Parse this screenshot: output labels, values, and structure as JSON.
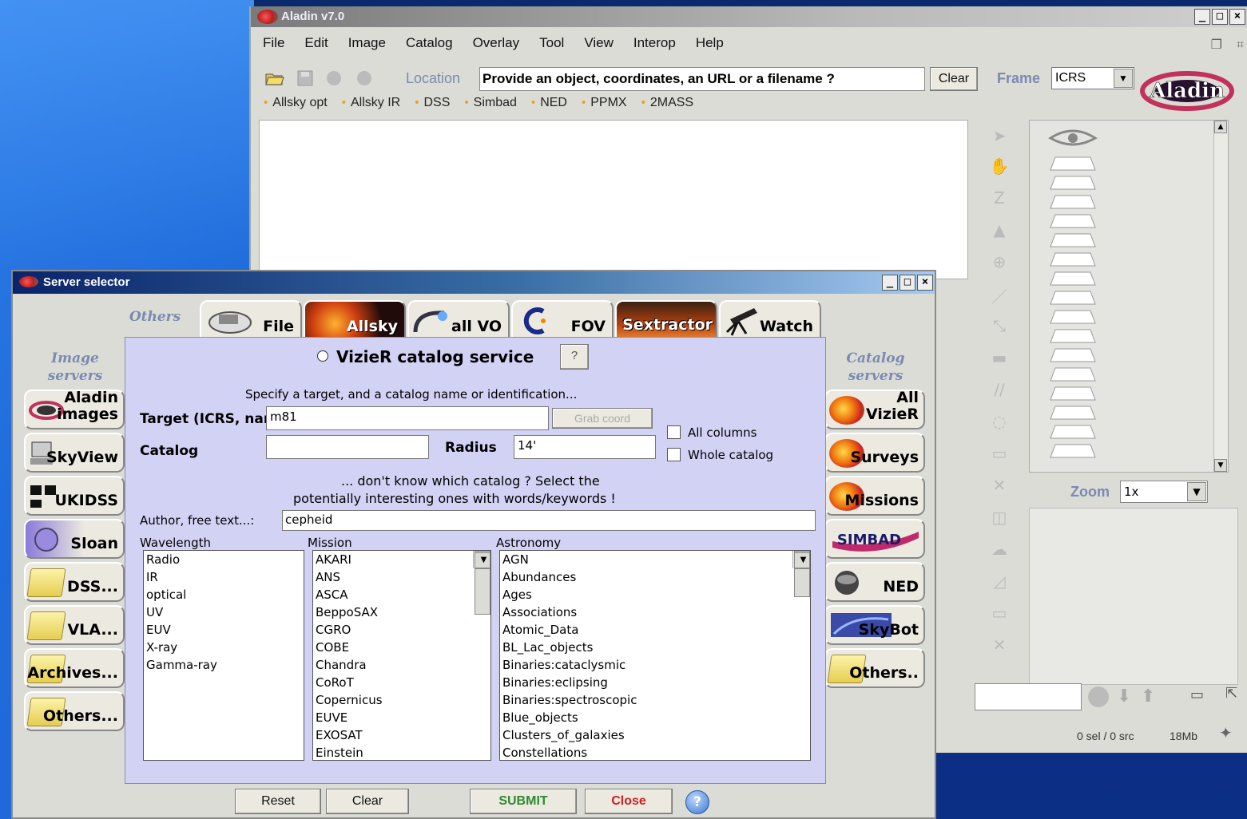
{
  "aladin": {
    "title": "Aladin v7.0",
    "menu": [
      "File",
      "Edit",
      "Image",
      "Catalog",
      "Overlay",
      "Tool",
      "View",
      "Interop",
      "Help"
    ],
    "location_label": "Location",
    "location_value": "Provide an object, coordinates, an URL or a filename ?",
    "clear_label": "Clear",
    "frame_label": "Frame",
    "frame_value": "ICRS",
    "logo_text": "Aladin",
    "quick_access": [
      "Allsky opt",
      "Allsky IR",
      "DSS",
      "Simbad",
      "NED",
      "PPMX",
      "2MASS"
    ],
    "zoom_label": "Zoom",
    "zoom_value": "1x",
    "selection_status": "0 sel / 0 src",
    "memory": "18Mb"
  },
  "server_selector": {
    "title": "Server selector",
    "others_label": "Others",
    "image_servers_label": [
      "Image",
      "servers"
    ],
    "catalog_servers_label": [
      "Catalog",
      "servers"
    ],
    "tabs": [
      "File",
      "Allsky",
      "all VO",
      "FOV",
      "Sextractor",
      "Watch"
    ],
    "image_servers": [
      [
        "Aladin",
        "images"
      ],
      [
        "SkyView"
      ],
      [
        "UKIDSS"
      ],
      [
        "Sloan"
      ],
      [
        "DSS..."
      ],
      [
        "VLA..."
      ],
      [
        "Archives..."
      ],
      [
        "Others..."
      ]
    ],
    "catalog_servers": [
      [
        "All",
        "VizieR"
      ],
      [
        "Surveys"
      ],
      [
        "Missions"
      ],
      [
        "SIMBAD"
      ],
      [
        "NED"
      ],
      [
        "SkyBot"
      ],
      [
        "Others.."
      ]
    ],
    "vizier": {
      "heading": "VizieR catalog service",
      "help_label": "?",
      "instructions": "Specify a target, and a catalog name or identification...",
      "target_label": "Target (ICRS, name)",
      "target_value": "m81",
      "grab_label": "Grab coord",
      "catalog_label": "Catalog",
      "catalog_value": "",
      "radius_label": "Radius",
      "radius_value": "14'",
      "all_columns_label": "All columns",
      "whole_catalog_label": "Whole catalog",
      "hint_line1": "... don't know which catalog ? Select the",
      "hint_line2": "potentially interesting ones with words/keywords !",
      "author_label": "Author, free text...:",
      "author_value": "cepheid",
      "wavelength_label": "Wavelength",
      "mission_label": "Mission",
      "astronomy_label": "Astronomy",
      "wavelength": [
        "Radio",
        "IR",
        "optical",
        "UV",
        "EUV",
        "X-ray",
        "Gamma-ray"
      ],
      "mission": [
        "AKARI",
        "ANS",
        "ASCA",
        "BeppoSAX",
        "CGRO",
        "COBE",
        "Chandra",
        "CoRoT",
        "Copernicus",
        "EUVE",
        "EXOSAT",
        "Einstein"
      ],
      "astronomy": [
        "AGN",
        "Abundances",
        "Ages",
        "Associations",
        "Atomic_Data",
        "BL_Lac_objects",
        "Binaries:cataclysmic",
        "Binaries:eclipsing",
        "Binaries:spectroscopic",
        "Blue_objects",
        "Clusters_of_galaxies",
        "Constellations"
      ]
    },
    "buttons": {
      "reset": "Reset",
      "clear": "Clear",
      "submit": "SUBMIT",
      "close": "Close",
      "help": "?"
    },
    "colors": {
      "submit": "#2e8b2e",
      "close": "#cc2020",
      "panel": "#d2d2f5",
      "side_label": "#7a8ab0"
    }
  }
}
